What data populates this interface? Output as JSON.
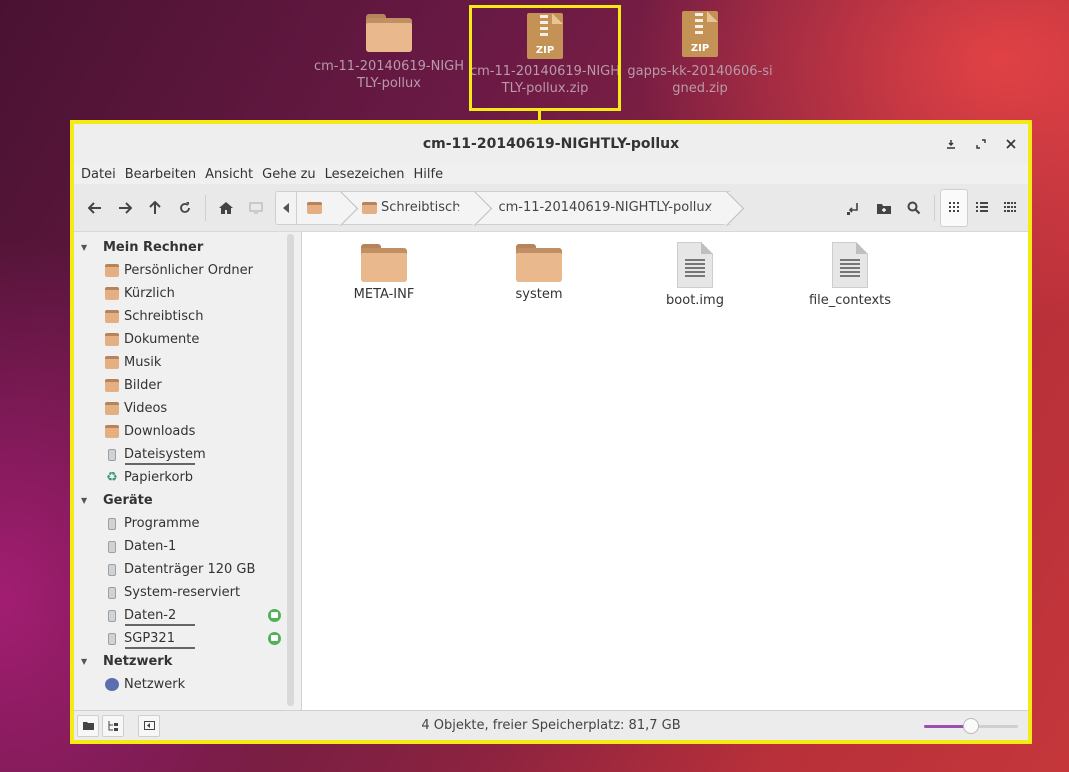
{
  "desktop": {
    "icons": [
      {
        "label": "cm-11-20140619-NIGHTLY-pollux",
        "type": "folder"
      },
      {
        "label": "cm-11-20140619-NIGHTLY-pollux.zip",
        "type": "zip",
        "badge": "ZIP"
      },
      {
        "label": "gapps-kk-20140606-signed.zip",
        "type": "zip",
        "badge": "ZIP"
      }
    ]
  },
  "window": {
    "title": "cm-11-20140619-NIGHTLY-pollux",
    "menu": [
      "Datei",
      "Bearbeiten",
      "Ansicht",
      "Gehe zu",
      "Lesezeichen",
      "Hilfe"
    ],
    "breadcrumb": [
      "Schreibtisch",
      "cm-11-20140619-NIGHTLY-pollux"
    ]
  },
  "sidebar": {
    "sections": [
      {
        "title": "Mein Rechner",
        "items": [
          "Persönlicher Ordner",
          "Kürzlich",
          "Schreibtisch",
          "Dokumente",
          "Musik",
          "Bilder",
          "Videos",
          "Downloads",
          "Dateisystem",
          "Papierkorb"
        ]
      },
      {
        "title": "Geräte",
        "items": [
          "Programme",
          "Daten-1",
          "Datenträger 120 GB",
          "System-reserviert",
          "Daten-2",
          "SGP321"
        ]
      },
      {
        "title": "Netzwerk",
        "items": [
          "Netzwerk"
        ]
      }
    ]
  },
  "files": [
    {
      "name": "META-INF",
      "type": "folder"
    },
    {
      "name": "system",
      "type": "folder"
    },
    {
      "name": "boot.img",
      "type": "document"
    },
    {
      "name": "file_contexts",
      "type": "document"
    }
  ],
  "status": {
    "text": "4 Objekte, freier Speicherplatz: 81,7 GB",
    "zoom_fraction": 0.5
  },
  "colors": {
    "highlight": "#f4ea16",
    "folder": "#e9b98d",
    "zoom_fill": "#9b4fb0",
    "eject_badge": "#52b05a"
  }
}
